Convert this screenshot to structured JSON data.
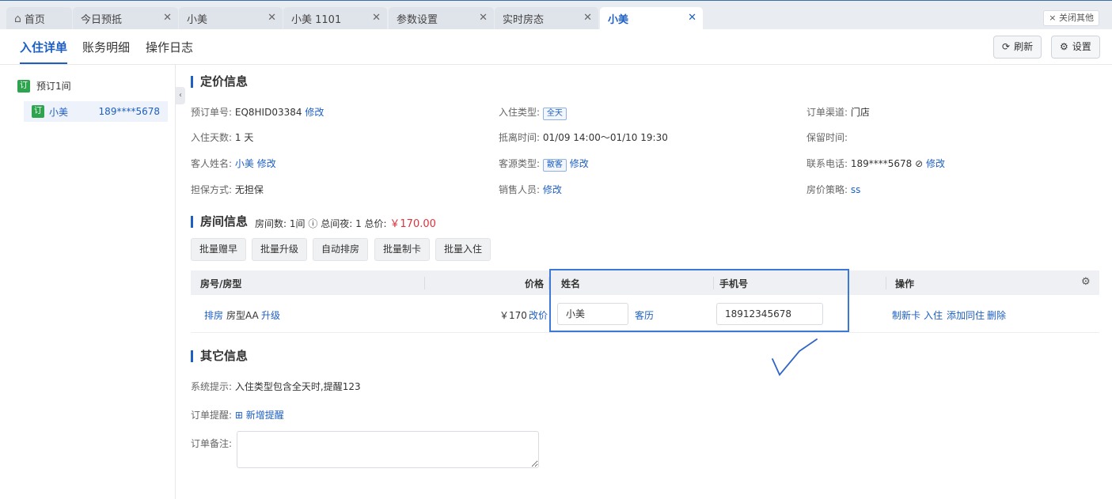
{
  "tabs": [
    {
      "label": "首页",
      "icon": "home-icon"
    },
    {
      "label": "今日预抵"
    },
    {
      "label": "小美"
    },
    {
      "label": "小美 1101"
    },
    {
      "label": "参数设置"
    },
    {
      "label": "实时房态"
    },
    {
      "label": "小美",
      "active": true
    }
  ],
  "close_others": "× 关闭其他",
  "subtabs": [
    "入住详单",
    "账务明细",
    "操作日志"
  ],
  "header_buttons": {
    "refresh": "刷新",
    "settings": "设置"
  },
  "sidebar": {
    "group_badge": "订",
    "group_label": "预订1间",
    "item_badge": "订",
    "item_name": "小美",
    "item_phone": "189****5678"
  },
  "pricing": {
    "title": "定价信息",
    "order_no_label": "预订单号:",
    "order_no": "EQ8HID03384",
    "edit": "修改",
    "checkin_type_label": "入住类型:",
    "checkin_type_tag": "全天",
    "channel_label": "订单渠道:",
    "channel": "门店",
    "days_label": "入住天数:",
    "days": "1 天",
    "arrive_label": "抵离时间:",
    "arrive": "01/09 14:00～01/10 19:30",
    "hold_label": "保留时间:",
    "guest_label": "客人姓名:",
    "guest": "小美",
    "source_label": "客源类型:",
    "source_tag": "散客",
    "phone_label": "联系电话:",
    "phone": "189****5678",
    "guarantee_label": "担保方式:",
    "guarantee": "无担保",
    "sales_label": "销售人员:",
    "rate_label": "房价策略:",
    "rate": "ss"
  },
  "room": {
    "title": "房间信息",
    "count_label": "房间数:",
    "count": "1间",
    "nights_label": "总间夜:",
    "nights": "1",
    "total_label": "总价:",
    "total": "￥170.00",
    "buttons": [
      "批量赠早",
      "批量升级",
      "自动排房",
      "批量制卡",
      "批量入住"
    ],
    "columns": {
      "room": "房号/房型",
      "price": "价格",
      "name": "姓名",
      "phone": "手机号",
      "ops": "操作"
    },
    "row": {
      "assign": "排房",
      "type": "房型AA",
      "upgrade": "升级",
      "price": "￥170",
      "change_price": "改价",
      "name": "小美",
      "history": "客历",
      "phone": "18912345678",
      "ops": [
        "制新卡",
        "入住",
        "添加同住",
        "删除"
      ]
    }
  },
  "other": {
    "title": "其它信息",
    "hint_label": "系统提示:",
    "hint": "入住类型包含全天时,提醒123",
    "reminder_label": "订单提醒:",
    "reminder_add": "新增提醒",
    "remark_label": "订单备注:"
  }
}
